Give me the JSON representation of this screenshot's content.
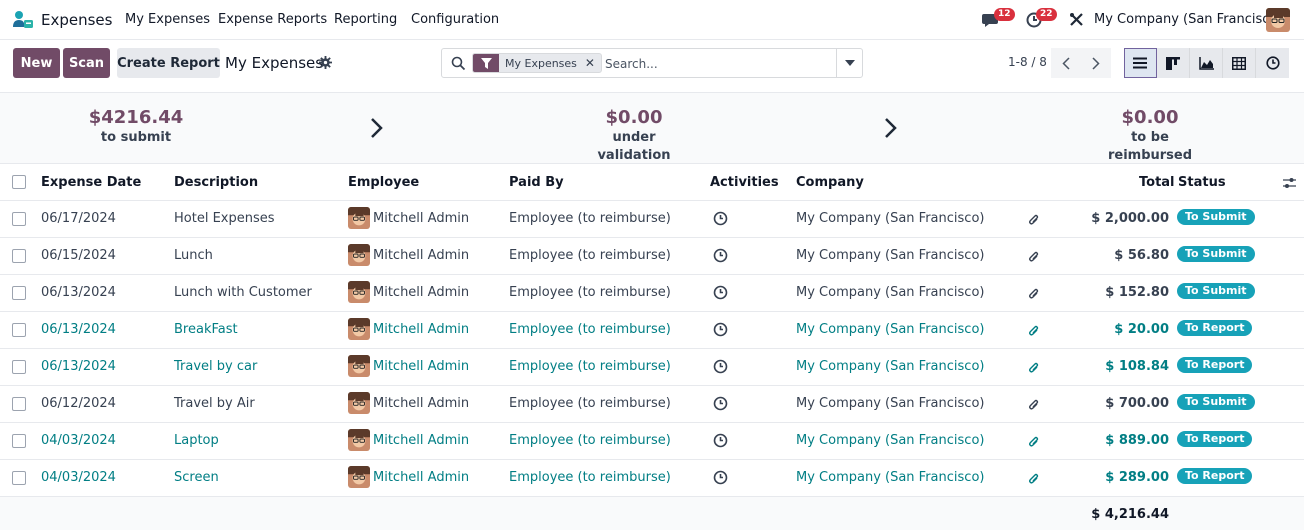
{
  "app": {
    "name": "Expenses"
  },
  "menu": [
    "My Expenses",
    "Expense Reports",
    "Reporting",
    "Configuration"
  ],
  "systray": {
    "messages_count": "12",
    "activities_count": "22",
    "company": "My Company (San Francisco)"
  },
  "control": {
    "new_label": "New",
    "scan_label": "Scan",
    "create_report_label": "Create Report",
    "title": "My Expenses",
    "facet_label": "My Expenses",
    "facet_close": "✕",
    "search_placeholder": "Search...",
    "pager": "1-8 / 8"
  },
  "summary": [
    {
      "amount": "$4216.44",
      "label": "to submit"
    },
    {
      "amount": "$0.00",
      "label": "under validation"
    },
    {
      "amount": "$0.00",
      "label": "to be reimbursed"
    }
  ],
  "columns": {
    "date": "Expense Date",
    "description": "Description",
    "employee": "Employee",
    "paid_by": "Paid By",
    "activities": "Activities",
    "company": "Company",
    "total": "Total",
    "status": "Status"
  },
  "rows": [
    {
      "date": "06/17/2024",
      "description": "Hotel Expenses",
      "employee": "Mitchell Admin",
      "paid_by": "Employee (to reimburse)",
      "company": "My Company (San Francisco)",
      "total": "$ 2,000.00",
      "status": "To Submit",
      "linked": false
    },
    {
      "date": "06/15/2024",
      "description": "Lunch",
      "employee": "Mitchell Admin",
      "paid_by": "Employee (to reimburse)",
      "company": "My Company (San Francisco)",
      "total": "$ 56.80",
      "status": "To Submit",
      "linked": false
    },
    {
      "date": "06/13/2024",
      "description": "Lunch with Customer",
      "employee": "Mitchell Admin",
      "paid_by": "Employee (to reimburse)",
      "company": "My Company (San Francisco)",
      "total": "$ 152.80",
      "status": "To Submit",
      "linked": false
    },
    {
      "date": "06/13/2024",
      "description": "BreakFast",
      "employee": "Mitchell Admin",
      "paid_by": "Employee (to reimburse)",
      "company": "My Company (San Francisco)",
      "total": "$ 20.00",
      "status": "To Report",
      "linked": true
    },
    {
      "date": "06/13/2024",
      "description": "Travel by car",
      "employee": "Mitchell Admin",
      "paid_by": "Employee (to reimburse)",
      "company": "My Company (San Francisco)",
      "total": "$ 108.84",
      "status": "To Report",
      "linked": true
    },
    {
      "date": "06/12/2024",
      "description": "Travel by Air",
      "employee": "Mitchell Admin",
      "paid_by": "Employee (to reimburse)",
      "company": "My Company (San Francisco)",
      "total": "$ 700.00",
      "status": "To Submit",
      "linked": false
    },
    {
      "date": "04/03/2024",
      "description": "Laptop",
      "employee": "Mitchell Admin",
      "paid_by": "Employee (to reimburse)",
      "company": "My Company (San Francisco)",
      "total": "$ 889.00",
      "status": "To Report",
      "linked": true
    },
    {
      "date": "04/03/2024",
      "description": "Screen",
      "employee": "Mitchell Admin",
      "paid_by": "Employee (to reimburse)",
      "company": "My Company (San Francisco)",
      "total": "$ 289.00",
      "status": "To Report",
      "linked": true
    }
  ],
  "footer": {
    "grand_total": "$ 4,216.44"
  },
  "colors": {
    "primary": "#714b67",
    "link": "#017e84",
    "badge": "#17a2b8",
    "notification": "#d9303d"
  }
}
